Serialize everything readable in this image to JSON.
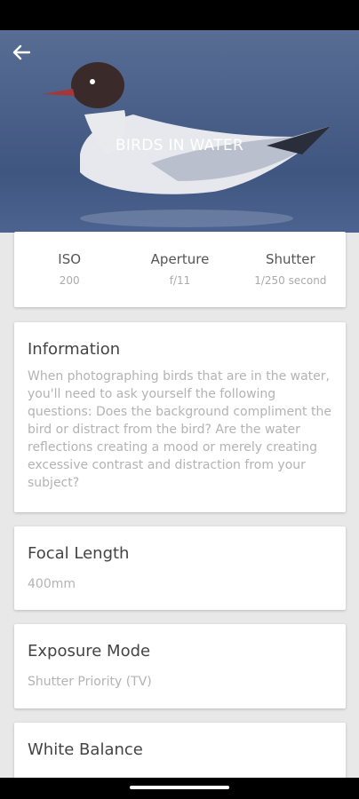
{
  "header": {
    "title": "BIRDS IN WATER"
  },
  "stats": [
    {
      "label": "ISO",
      "value": "200"
    },
    {
      "label": "Aperture",
      "value": "f/11"
    },
    {
      "label": "Shutter",
      "value": "1/250 second"
    }
  ],
  "information": {
    "title": "Information",
    "text": "When photographing birds that are in the water, you'll need to ask yourself the following questions: Does the background compliment the bird or distract from the bird? Are the water reflections creating a mood or merely creating excessive contrast and distraction from your subject?"
  },
  "focal_length": {
    "title": "Focal Length",
    "value": "400mm"
  },
  "exposure_mode": {
    "title": "Exposure Mode",
    "value": "Shutter Priority (TV)"
  },
  "white_balance": {
    "title": "White Balance"
  },
  "colors": {
    "hero_sky": "#5a6f94",
    "card_bg": "#ffffff",
    "screen_bg": "#e8e8e8"
  },
  "icons": {
    "back": "arrow-left-icon"
  }
}
